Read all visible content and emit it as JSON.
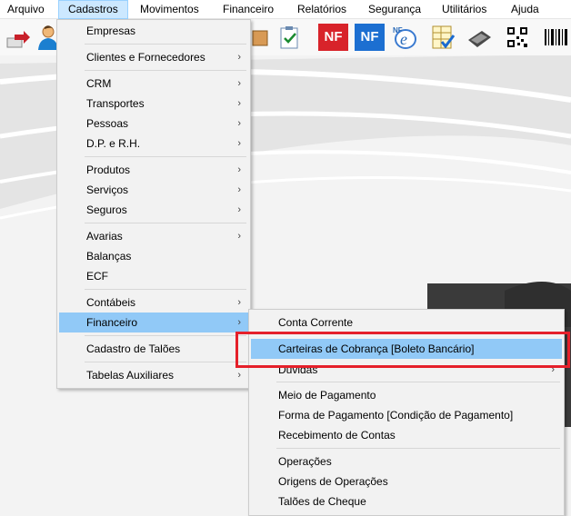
{
  "menubar": {
    "items": [
      {
        "label": "Arquivo"
      },
      {
        "label": "Cadastros"
      },
      {
        "label": "Movimentos"
      },
      {
        "label": "Financeiro"
      },
      {
        "label": "Relatórios"
      },
      {
        "label": "Segurança"
      },
      {
        "label": "Utilitários"
      },
      {
        "label": "Ajuda"
      }
    ]
  },
  "toolbar": {
    "nf_label": "NF",
    "nfe_label": "NF"
  },
  "cadastros_menu": {
    "items": [
      {
        "label": "Empresas"
      },
      {
        "label": "Clientes e Fornecedores"
      },
      {
        "label": "CRM"
      },
      {
        "label": "Transportes"
      },
      {
        "label": "Pessoas"
      },
      {
        "label": "D.P. e R.H."
      },
      {
        "label": "Produtos"
      },
      {
        "label": "Serviços"
      },
      {
        "label": "Seguros"
      },
      {
        "label": "Avarias"
      },
      {
        "label": "Balanças"
      },
      {
        "label": "ECF"
      },
      {
        "label": "Contábeis"
      },
      {
        "label": "Financeiro"
      },
      {
        "label": "Cadastro de Talões"
      },
      {
        "label": "Tabelas Auxiliares"
      }
    ],
    "arrow": "›"
  },
  "financeiro_submenu": {
    "items": [
      {
        "label": "Conta Corrente"
      },
      {
        "label": "Carteiras de Cobrança [Boleto Bancário]"
      },
      {
        "label": "Dúvidas"
      },
      {
        "label": "Meio de Pagamento"
      },
      {
        "label": "Forma de Pagamento [Condição de Pagamento]"
      },
      {
        "label": "Recebimento de Contas"
      },
      {
        "label": "Operações"
      },
      {
        "label": "Origens de Operações"
      },
      {
        "label": "Talões de Cheque"
      }
    ]
  },
  "colors": {
    "highlight": "#91c9f7",
    "annotation_box": "#e5202a",
    "nf_red": "#d8232a",
    "nf_blue": "#1c6fd1"
  }
}
